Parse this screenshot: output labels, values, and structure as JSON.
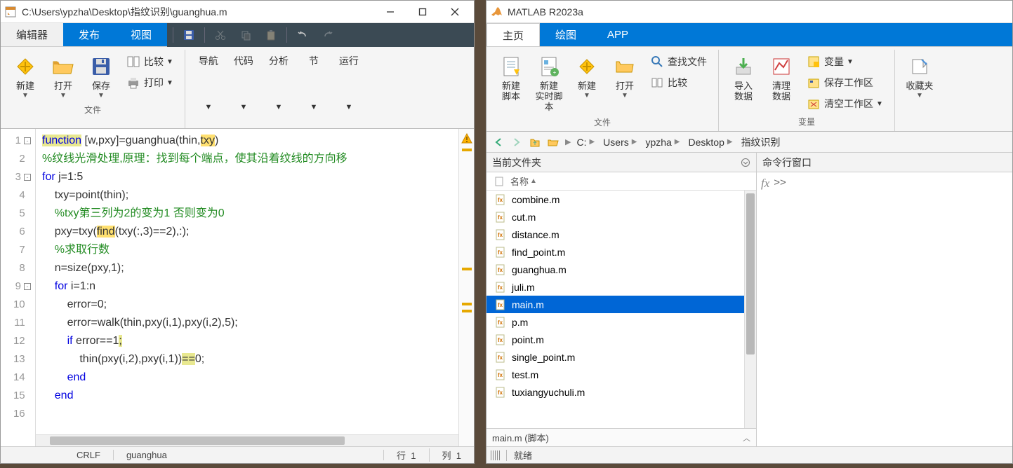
{
  "editor": {
    "title": "C:\\Users\\ypzha\\Desktop\\指纹识别\\guanghua.m",
    "tabs": [
      "编辑器",
      "发布",
      "视图"
    ],
    "ribbon": {
      "file_group": "文件",
      "new": "新建",
      "open": "打开",
      "save": "保存",
      "compare": "比较",
      "print": "打印",
      "nav": "导航",
      "code": "代码",
      "analyze": "分析",
      "section": "节",
      "run": "运行"
    },
    "lines": 16,
    "status": {
      "encoding": "CRLF",
      "func": "guanghua",
      "row_label": "行",
      "row": "1",
      "col_label": "列",
      "col": "1"
    },
    "code": {
      "l1a": "function",
      "l1b": " [w,pxy]=guanghua(thin,",
      "l1c": "txy",
      "l1d": ")",
      "l2": "%纹线光滑处理,原理：找到每个端点，使其沿着纹线的方向移",
      "l3a": "for",
      "l3b": " j=1:5",
      "l4": "    txy=point(thin);",
      "l5": "    %txy第三列为2的变为1 否则变为0",
      "l6a": "    pxy=txy(",
      "l6b": "find",
      "l6c": "(txy(:,3)==2),:);",
      "l7": "    %求取行数",
      "l8": "    n=size(pxy,1);",
      "l9a": "    for",
      "l9b": " i=1:n",
      "l10": "        error=0;",
      "l11": "        error=walk(thin,pxy(i,1),pxy(i,2),5);",
      "l12a": "        if",
      "l12b": " error==1",
      "l12c": ";",
      "l13a": "            thin(pxy(i,2),pxy(i,1))",
      "l13b": "==",
      "l13c": "0;",
      "l14": "        end",
      "l15": "    end"
    }
  },
  "matlab": {
    "title": "MATLAB R2023a",
    "tabs": [
      "主页",
      "绘图",
      "APP"
    ],
    "ribbon": {
      "new_script": "新建\n脚本",
      "new_live": "新建\n实时脚本",
      "new": "新建",
      "open": "打开",
      "find_files": "查找文件",
      "compare": "比较",
      "import": "导入\n数据",
      "clean": "清理\n数据",
      "var": "变量",
      "save_ws": "保存工作区",
      "clear_ws": "清空工作区",
      "fav": "收藏夹",
      "g_file": "文件",
      "g_var": "变量"
    },
    "breadcrumb": [
      "C:",
      "Users",
      "ypzha",
      "Desktop",
      "指纹识别"
    ],
    "current_folder_label": "当前文件夹",
    "name_col": "名称",
    "files": [
      "combine.m",
      "cut.m",
      "distance.m",
      "find_point.m",
      "guanghua.m",
      "juli.m",
      "main.m",
      "p.m",
      "point.m",
      "single_point.m",
      "test.m",
      "tuxiangyuchuli.m"
    ],
    "selected": "main.m",
    "detail": "main.m  (脚本)",
    "cmd_label": "命令行窗口",
    "prompt": ">>",
    "status": "就绪"
  }
}
